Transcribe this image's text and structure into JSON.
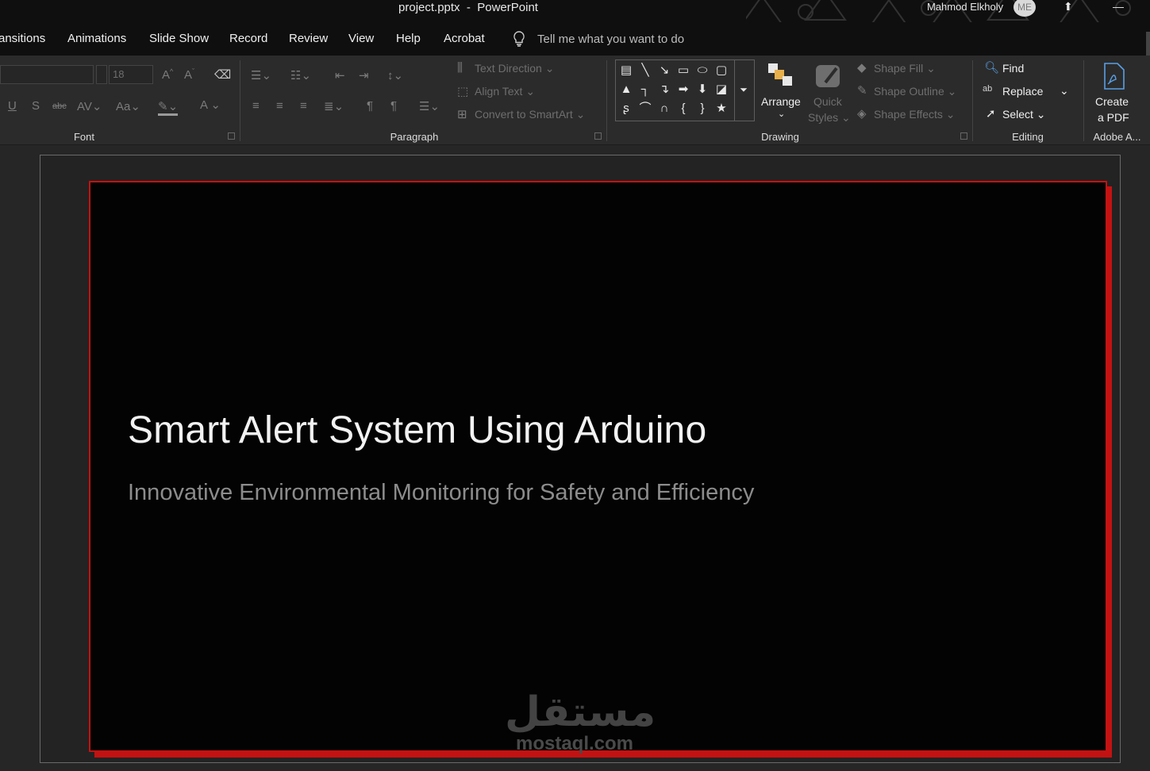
{
  "titlebar": {
    "document": "project.pptx",
    "separator": "-",
    "app": "PowerPoint",
    "user_name": "Mahmod Elkholy",
    "avatar_initials": "ME"
  },
  "menu": {
    "tabs": [
      "ansitions",
      "Animations",
      "Slide Show",
      "Record",
      "Review",
      "View",
      "Help",
      "Acrobat"
    ],
    "tell_me": "Tell me what you want to do"
  },
  "ribbon": {
    "font": {
      "label": "Font",
      "size_value": "18",
      "case_label": "Aa"
    },
    "paragraph": {
      "label": "Paragraph",
      "text_direction": "Text Direction",
      "align_text": "Align Text",
      "convert_smartart": "Convert to SmartArt"
    },
    "drawing": {
      "label": "Drawing",
      "arrange": "Arrange",
      "quick_styles_1": "Quick",
      "quick_styles_2": "Styles",
      "shape_fill": "Shape Fill",
      "shape_outline": "Shape Outline",
      "shape_effects": "Shape Effects"
    },
    "editing": {
      "label": "Editing",
      "find": "Find",
      "replace": "Replace",
      "select": "Select"
    },
    "adobe": {
      "label": "Adobe A...",
      "create_pdf_1": "Create",
      "create_pdf_2": "a PDF"
    }
  },
  "slide": {
    "title": "Smart Alert System Using Arduino",
    "subtitle": "Innovative Environmental Monitoring for Safety and Efficiency",
    "watermark_ar": "مستقل",
    "watermark_en": "mostaql.com"
  },
  "colors": {
    "accent_red": "#c41212",
    "titlebar_bg": "#0f0f0f",
    "ribbon_bg": "#2b2b2b"
  }
}
